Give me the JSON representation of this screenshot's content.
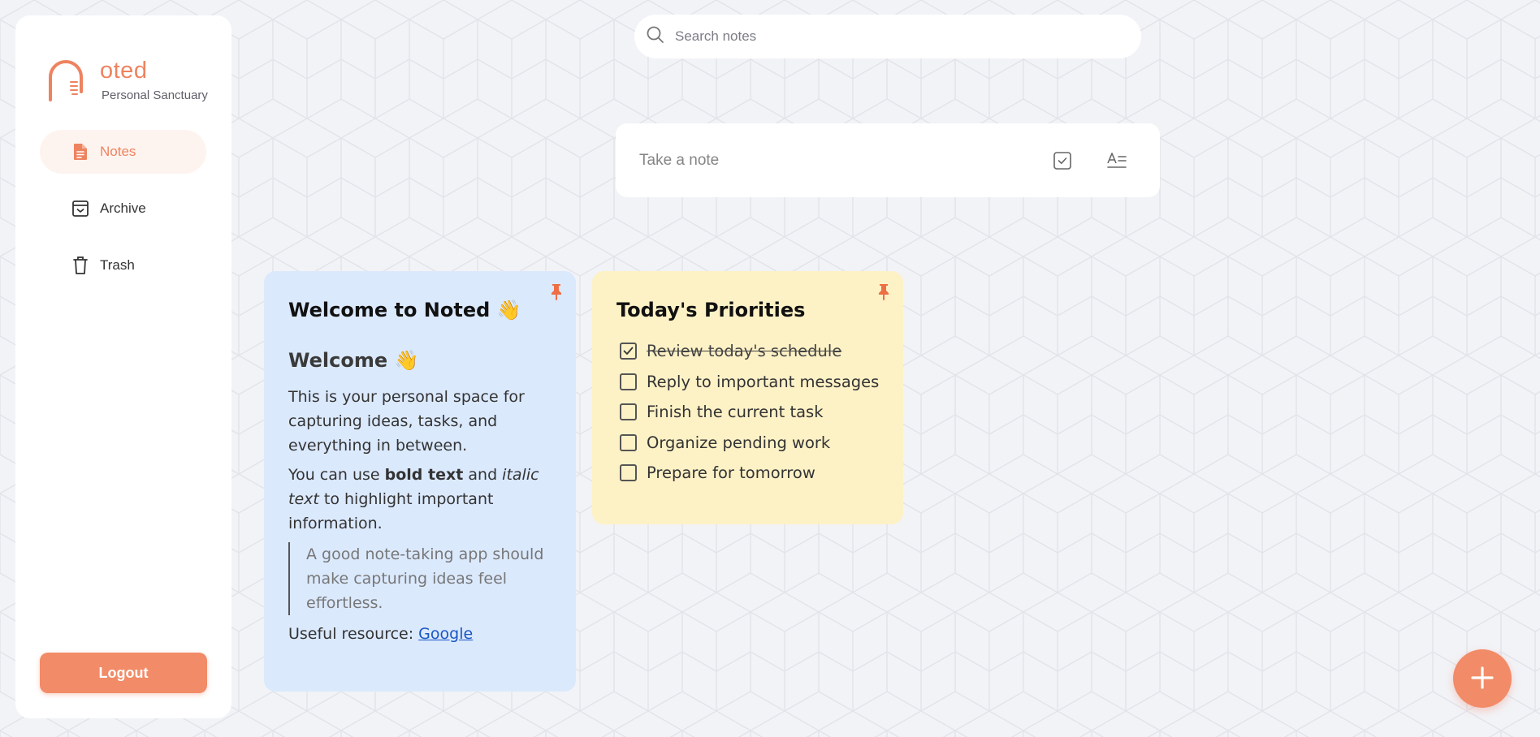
{
  "brand": {
    "name": "oted",
    "tagline": "Personal Sanctuary",
    "accent": "#ee8360"
  },
  "sidebar": {
    "items": [
      {
        "label": "Notes",
        "icon": "document-icon",
        "active": true
      },
      {
        "label": "Archive",
        "icon": "archive-icon",
        "active": false
      },
      {
        "label": "Trash",
        "icon": "trash-icon",
        "active": false
      }
    ],
    "logout_label": "Logout"
  },
  "search": {
    "placeholder": "Search notes",
    "icon": "search-icon"
  },
  "composer": {
    "placeholder": "Take a note",
    "checklist_icon": "checkbox-icon",
    "text_icon": "text-format-icon"
  },
  "notes": [
    {
      "title": "Welcome to Noted 👋",
      "color": "#dbe9fd",
      "pinned": true,
      "heading": "Welcome 👋",
      "para1": "This is your personal space for capturing ideas, tasks, and everything in between.",
      "para2_before": "You can use ",
      "para2_bold": "bold text",
      "para2_mid": " and ",
      "para2_italic": "italic text",
      "para2_after": " to highlight important information.",
      "quote": "A good note-taking app should make capturing ideas feel effortless.",
      "resource_label": "Useful resource: ",
      "resource_link": "Google"
    },
    {
      "title": "Today's Priorities",
      "color": "#fdf1c6",
      "pinned": true,
      "items": [
        {
          "text": "Review today's schedule",
          "checked": true
        },
        {
          "text": "Reply to important messages",
          "checked": false
        },
        {
          "text": "Finish the current task",
          "checked": false
        },
        {
          "text": "Organize pending work",
          "checked": false
        },
        {
          "text": "Prepare for tomorrow",
          "checked": false
        }
      ]
    }
  ],
  "fab": {
    "icon": "plus-icon"
  }
}
